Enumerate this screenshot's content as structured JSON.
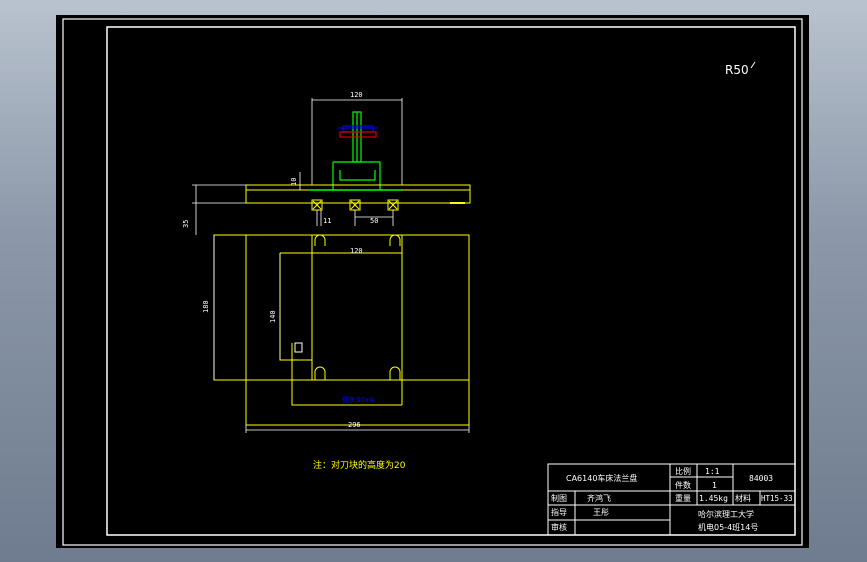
{
  "drawing": {
    "roughness": "R50",
    "dims": {
      "top_width": "120",
      "height_small": "10",
      "left_35": "35",
      "offset_11": "11",
      "spacing_50": "50",
      "plate_width_inner": "120",
      "plate_height": "180",
      "inner_height": "140",
      "overall_width": "296"
    },
    "blue_label": "键B 10x4",
    "note": "注：对刀块的高度为20"
  },
  "title_block": {
    "title": "CA6140车床法兰盘",
    "scale_label": "比例",
    "scale_value": "1:1",
    "qty_label": "件数",
    "qty_value": "1",
    "drawing_no": "84003",
    "weight_label": "重量",
    "weight_value": "1.45kg",
    "material_label": "材料",
    "material_value": "HT15-33",
    "drawn_label": "制图",
    "drawn_name": "齐鸿飞",
    "guide_label": "指导",
    "guide_name": "王彤",
    "review_label": "审核",
    "school": "哈尔滨理工大学",
    "class_info": "机电05-4班14号"
  },
  "colors": {
    "frame": "#ffffff",
    "yellow": "#ffff00",
    "green": "#00ff00",
    "blue": "#0000ff",
    "red": "#ff0000"
  }
}
